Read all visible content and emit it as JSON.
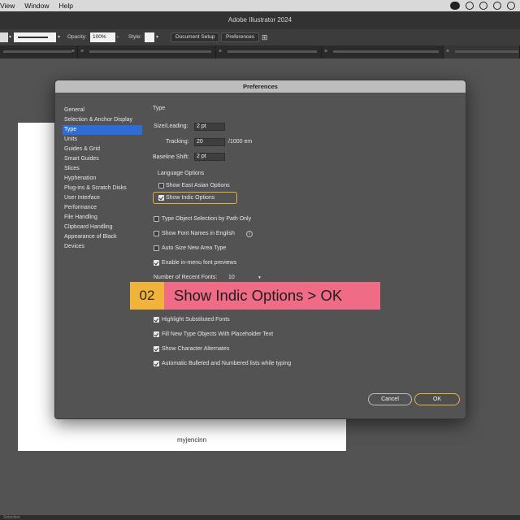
{
  "menubar": {
    "items": [
      "View",
      "Window",
      "Help"
    ]
  },
  "app": {
    "title": "Adobe Illustrator 2024"
  },
  "controlbar": {
    "opacity_label": "Opacity:",
    "opacity_value": "100%",
    "style_label": "Style:",
    "document_setup": "Document Setup",
    "preferences": "Preferences"
  },
  "dialog": {
    "title": "Preferences",
    "nav": [
      "General",
      "Selection & Anchor Display",
      "Type",
      "Units",
      "Guides & Grid",
      "Smart Guides",
      "Slices",
      "Hyphenation",
      "Plug-ins & Scratch Disks",
      "User Interface",
      "Performance",
      "File Handling",
      "Clipboard Handling",
      "Appearance of Black",
      "Devices"
    ],
    "active_nav": "Type",
    "type": {
      "section_title": "Type",
      "size_leading_label": "Size/Leading:",
      "size_leading_value": "2 pt",
      "tracking_label": "Tracking:",
      "tracking_value": "20",
      "tracking_unit": "/1000 em",
      "baseline_label": "Baseline Shift:",
      "baseline_value": "2 pt",
      "language_options_label": "Language Options",
      "show_east_asian": {
        "label": "Show East Asian Options",
        "checked": false
      },
      "show_indic": {
        "label": "Show Indic Options",
        "checked": true
      },
      "type_object_selection": {
        "label": "Type Object Selection by Path Only",
        "checked": false
      },
      "font_names_english": {
        "label": "Show Font Names in English",
        "checked": false
      },
      "auto_size": {
        "label": "Auto Size New Area Type",
        "checked": false
      },
      "font_previews": {
        "label": "Enable in-menu font previews",
        "checked": true
      },
      "recent_fonts_label": "Number of Recent Fonts:",
      "recent_fonts_value": "10",
      "highlight_substituted": {
        "label": "Highlight Substituted Fonts",
        "checked": true
      },
      "fill_placeholder": {
        "label": "Fill New Type Objects With Placeholder Text",
        "checked": true
      },
      "show_char_alternates": {
        "label": "Show Character Alternates",
        "checked": true
      },
      "auto_lists": {
        "label": "Automatic Bulleted and Numbered lists while typing",
        "checked": true
      }
    },
    "cancel_label": "Cancel",
    "ok_label": "OK"
  },
  "banner": {
    "step": "02",
    "text": "Show Indic Options > OK"
  },
  "artboard": {
    "caption": "myjencinn"
  },
  "statusbar": {
    "text": "Selection"
  },
  "colors": {
    "accent_highlight": "#e6b33a",
    "banner_step_bg": "#f2b33a",
    "banner_text_bg": "#f06b85",
    "nav_selected": "#2f6dd6"
  }
}
